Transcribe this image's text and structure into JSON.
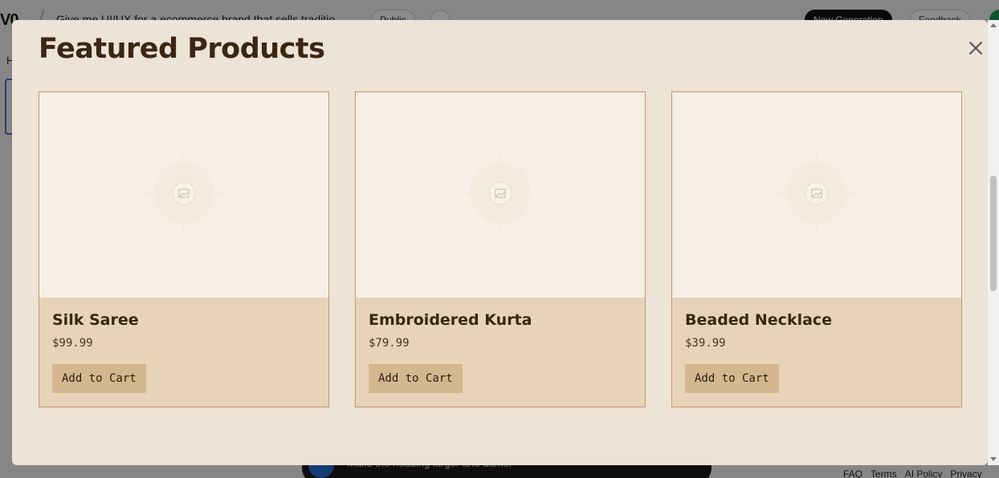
{
  "background": {
    "logo": "V0",
    "prompt": "Give me UI/UX for a ecommerce brand that sells traditio",
    "public_label": "Public",
    "more_label": "···",
    "new_generation_label": "New Generation",
    "feedback_label": "Feedback",
    "heading_initial": "H",
    "chat_placeholder": "Make the heading larger and darker",
    "footer": [
      "FAQ",
      "Terms",
      "AI Policy",
      "Privacy"
    ]
  },
  "modal": {
    "title": "Featured Products",
    "close_icon": "close-icon",
    "products": [
      {
        "name": "Silk Saree",
        "price": "$99.99",
        "button": "Add to Cart",
        "image_icon": "image-placeholder-icon"
      },
      {
        "name": "Embroidered Kurta",
        "price": "$79.99",
        "button": "Add to Cart",
        "image_icon": "image-placeholder-icon"
      },
      {
        "name": "Beaded Necklace",
        "price": "$39.99",
        "button": "Add to Cart",
        "image_icon": "image-placeholder-icon"
      }
    ]
  },
  "colors": {
    "modal_bg": "#ede3d6",
    "title": "#3a2713",
    "card_border": "#c49a62",
    "card_footer": "#e6d3b9",
    "image_bg": "#f6efe6",
    "button_bg": "#d3b78e"
  }
}
